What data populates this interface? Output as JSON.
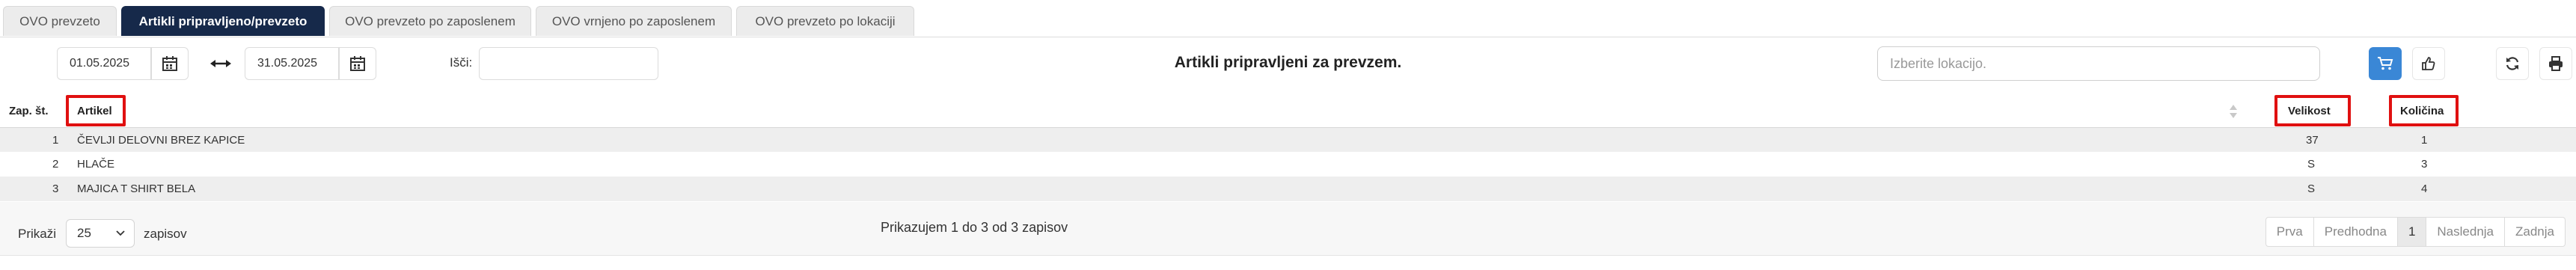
{
  "tabs": [
    {
      "label": "OVO prevzeto"
    },
    {
      "label": "Artikli pripravljeno/prevzeto"
    },
    {
      "label": "OVO prevzeto po zaposlenem"
    },
    {
      "label": "OVO vrnjeno po zaposlenem"
    },
    {
      "label": "OVO prevzeto po lokaciji"
    }
  ],
  "toolbar": {
    "date_from": "01.05.2025",
    "date_to": "31.05.2025",
    "search_label": "Išči:",
    "search_value": "",
    "title": "Artikli pripravljeni za prevzem.",
    "location_placeholder": "Izberite lokacijo."
  },
  "table": {
    "columns": {
      "no": "Zap. št.",
      "article": "Artikel",
      "size": "Velikost",
      "qty": "Količina"
    },
    "rows": [
      {
        "no": "1",
        "article": "ČEVLJI DELOVNI BREZ KAPICE",
        "size": "37",
        "qty": "1"
      },
      {
        "no": "2",
        "article": "HLAČE",
        "size": "S",
        "qty": "3"
      },
      {
        "no": "3",
        "article": "MAJICA T SHIRT BELA",
        "size": "S",
        "qty": "4"
      }
    ]
  },
  "footer": {
    "show_label": "Prikaži",
    "page_size": "25",
    "records_label": "zapisov",
    "info": "Prikazujem 1 do 3 od 3 zapisov",
    "pager": {
      "first": "Prva",
      "prev": "Predhodna",
      "current": "1",
      "next": "Naslednja",
      "last": "Zadnja"
    }
  },
  "colors": {
    "active_tab": "#16294a",
    "primary_button": "#3a87d6",
    "highlight": "#e01010"
  }
}
